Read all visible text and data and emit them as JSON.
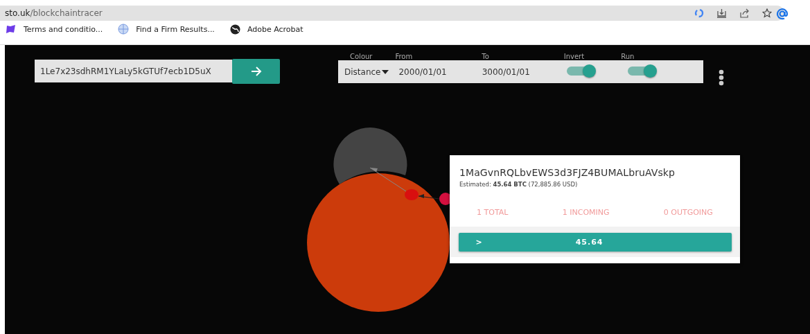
{
  "browser": {
    "url_host": "sto.uk",
    "url_path": "/blockchaintracer",
    "bookmarks": [
      {
        "label": "Terms and conditio..."
      },
      {
        "label": "Find a Firm Results..."
      },
      {
        "label": "Adobe Acrobat"
      }
    ]
  },
  "search": {
    "value": "1Le7x23sdhRM1YLaLy5kGTUf7ecb1D5uX"
  },
  "toolbar": {
    "colour": {
      "label": "Colour",
      "value": "Distance"
    },
    "from": {
      "label": "From",
      "value": "2000/01/01"
    },
    "to": {
      "label": "To",
      "value": "3000/01/01"
    },
    "invert": {
      "label": "Invert",
      "on": true
    },
    "run": {
      "label": "Run",
      "on": true
    }
  },
  "graph": {
    "nodes": [
      {
        "color": "#444444"
      },
      {
        "color": "#cc3b0b"
      },
      {
        "color": "#d90f0f"
      },
      {
        "color": "#d4103f"
      }
    ]
  },
  "card": {
    "address": "1MaGvnRQLbvEWS3d3FJZ4BUMALbruAVskp",
    "estimate": "Estimated: **45.64 BTC** (72,885.86 USD)",
    "stats": [
      "1 TOTAL",
      "1 INCOMING",
      "0 OUTGOING"
    ],
    "button": {
      "arrow": ">",
      "value": "45.64"
    }
  }
}
